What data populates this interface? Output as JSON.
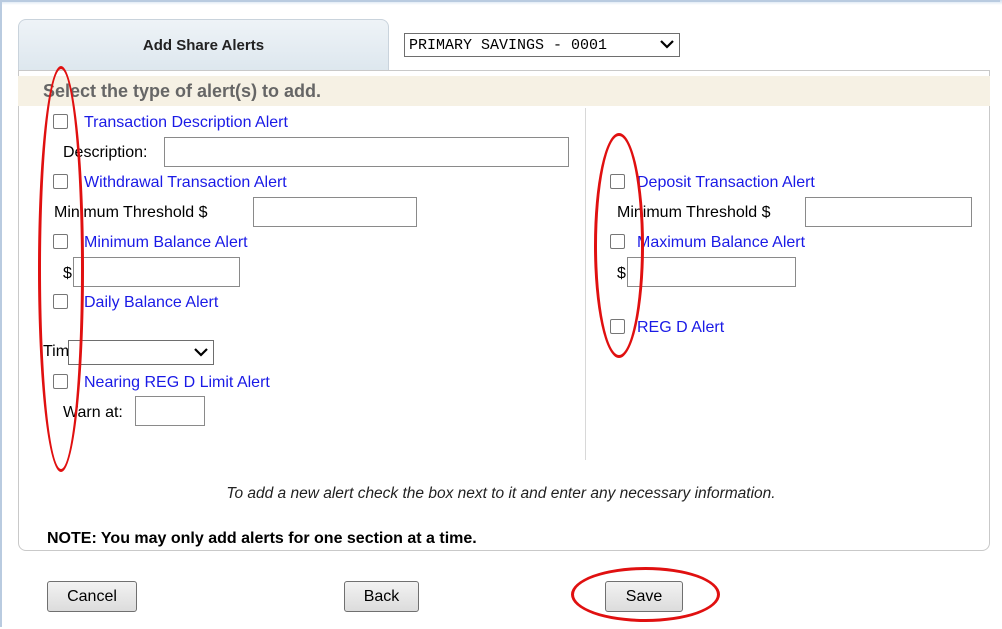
{
  "tab": {
    "label": "Add Share Alerts"
  },
  "account": {
    "selected": "PRIMARY SAVINGS - 0001"
  },
  "section_heading": "Select the type of alert(s) to add.",
  "left_alerts": {
    "transaction_description": {
      "label": "Transaction Description Alert",
      "field_label": "Description:"
    },
    "withdrawal": {
      "label": "Withdrawal Transaction Alert",
      "field_label": "Minimum Threshold $"
    },
    "minimum_balance": {
      "label": "Minimum Balance Alert",
      "field_label": "$"
    },
    "daily_balance": {
      "label": "Daily Balance Alert",
      "time_label": "Time"
    },
    "nearing_reg_d": {
      "label": "Nearing REG D Limit Alert",
      "field_label": "Warn at:"
    }
  },
  "right_alerts": {
    "deposit": {
      "label": "Deposit Transaction Alert",
      "field_label": "Minimum Threshold $"
    },
    "maximum_balance": {
      "label": "Maximum Balance Alert",
      "field_label": "$"
    },
    "reg_d": {
      "label": "REG D Alert"
    }
  },
  "instructions": "To add a new alert check the box next to it and enter any necessary information.",
  "note": "NOTE: You may only add alerts for one section at a time.",
  "buttons": {
    "cancel": "Cancel",
    "back": "Back",
    "save": "Save"
  },
  "colors": {
    "link": "#1a1ae6",
    "annotation": "#e01010",
    "heading_bg": "#f6f1e4"
  },
  "icons": {
    "select_arrow": "chevron-down-icon"
  }
}
